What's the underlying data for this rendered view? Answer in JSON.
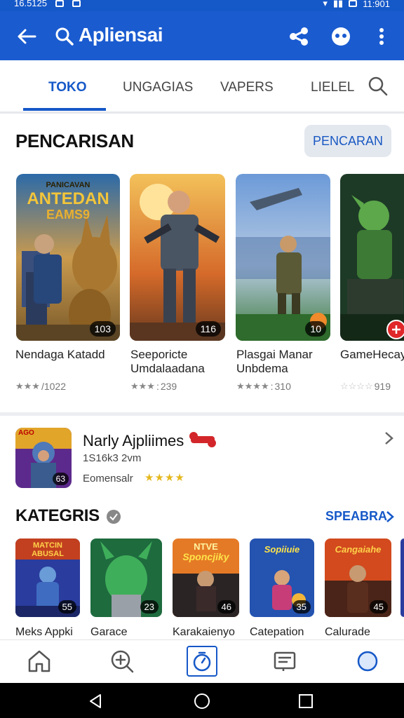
{
  "status_bar": {
    "time_left": "16.5125",
    "time_right": "11:901"
  },
  "app_bar": {
    "title": "Apliensai",
    "icons": [
      "back-arrow-icon",
      "search-icon",
      "share-icon",
      "gamepad-icon",
      "more-vert-icon"
    ]
  },
  "tabs": [
    {
      "label": "TOKO",
      "active": true
    },
    {
      "label": "UNGAGIAS",
      "active": false
    },
    {
      "label": "VAPERS",
      "active": false
    },
    {
      "label": "LIELEL",
      "active": false
    }
  ],
  "search_section": {
    "title": "PENCARISAN",
    "button_label": "PENCARAN",
    "cards": [
      {
        "name": "Nendaga Katadd",
        "count": "103",
        "rating_text": "/1022",
        "stars": 3,
        "banner": [
          "PANICAVAN",
          "ANTEDAN",
          "EAMS9"
        ]
      },
      {
        "name": "Seeporicte Umdalaadana",
        "count": "116",
        "rating_text": "239",
        "stars": 3
      },
      {
        "name": "Plasgai Manar Unbdema",
        "count": "10",
        "rating_text": "310",
        "stars": 4
      },
      {
        "name": "GameHecay",
        "count": "",
        "rating_text": "919",
        "stars": 4
      }
    ]
  },
  "featured": {
    "title": "Narly Ajpliimes",
    "subtitle": "1S16k3 2vm",
    "developer": "Eomensalr",
    "stars": "★★★★",
    "icon_badge": "63",
    "icon_label": "AGO"
  },
  "categories": {
    "title": "KATEGRIS",
    "see_all": "SPEABRA",
    "items": [
      {
        "name": "Meks Appki",
        "count": "55",
        "banner": [
          "MATCIN",
          "ABUSAL"
        ]
      },
      {
        "name": "Garace",
        "count": "23"
      },
      {
        "name": "Karakaienyo",
        "count": "46",
        "banner": [
          "NTVE",
          "Sponcjiky"
        ]
      },
      {
        "name": "Catepation",
        "count": "35",
        "banner": [
          "Sopiiuie"
        ]
      },
      {
        "name": "Calurade",
        "count": "45",
        "banner": [
          "Cangaiahe"
        ]
      }
    ]
  },
  "bottom_nav": [
    "home-icon",
    "zoom-in-icon",
    "timer-icon",
    "news-icon",
    "profile-icon"
  ],
  "colors": {
    "primary": "#1a5bd0",
    "accent_text": "#1558c8",
    "star_gold": "#e5b81f"
  }
}
